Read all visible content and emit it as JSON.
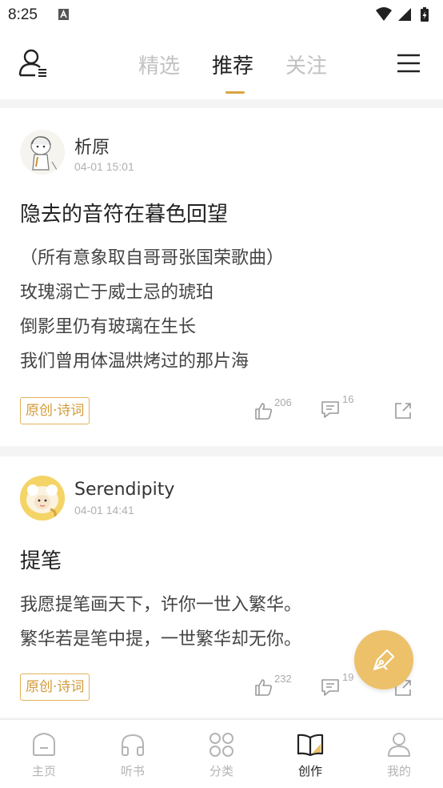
{
  "status_bar": {
    "time": "8:25",
    "icons": [
      "a-notification-icon",
      "wifi-icon",
      "signal-icon",
      "battery-charging-icon"
    ]
  },
  "top_nav": {
    "left_icon": "user-menu-icon",
    "tabs": [
      {
        "label": "精选",
        "active": false
      },
      {
        "label": "推荐",
        "active": true
      },
      {
        "label": "关注",
        "active": false
      }
    ],
    "right_icon": "hamburger-menu-icon",
    "accent_color": "#d9a441"
  },
  "posts": [
    {
      "author": "析原",
      "time": "04-01 15:01",
      "title": "隐去的音符在暮色回望",
      "lines": [
        "（所有意象取自哥哥张国荣歌曲）",
        "玫瑰溺亡于威士忌的琥珀",
        "倒影里仍有玻璃在生长",
        "我们曾用体温烘烤过的那片海"
      ],
      "tag": "原创·诗词",
      "likes": "206",
      "comments": "16"
    },
    {
      "author": "Serendipity",
      "time": "04-01 14:41",
      "title": "提笔",
      "lines": [
        "我愿提笔画天下，许你一世入繁华。",
        "繁华若是笔中提，一世繁华却无你。"
      ],
      "tag": "原创·诗词",
      "likes": "232",
      "comments": "19"
    }
  ],
  "fab": {
    "icon": "pen-write-icon",
    "color": "#ecc16a"
  },
  "bottom_nav": [
    {
      "label": "主页",
      "icon": "home-icon",
      "active": false
    },
    {
      "label": "听书",
      "icon": "headphones-icon",
      "active": false
    },
    {
      "label": "分类",
      "icon": "category-grid-icon",
      "active": false
    },
    {
      "label": "创作",
      "icon": "open-book-icon",
      "active": true
    },
    {
      "label": "我的",
      "icon": "profile-icon",
      "active": false
    }
  ]
}
